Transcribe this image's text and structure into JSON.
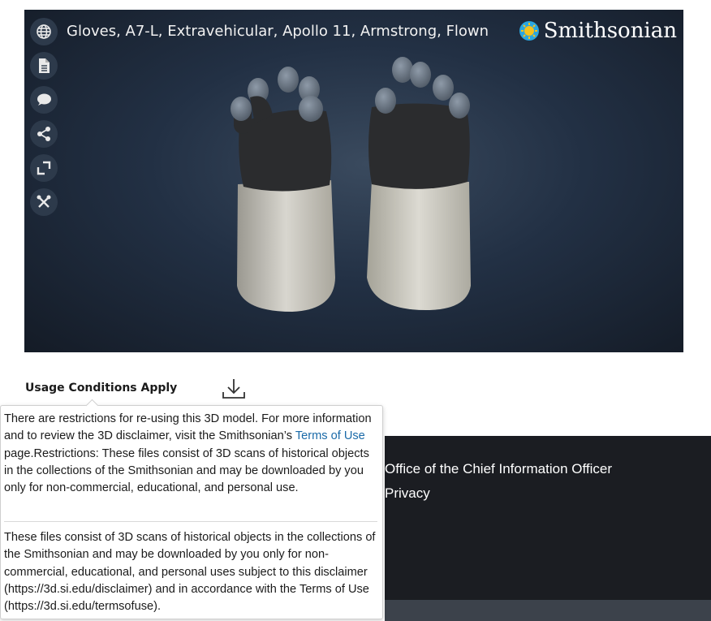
{
  "viewer": {
    "title": "Gloves, A7-L, Extravehicular, Apollo 11, Armstrong, Flown",
    "brand": "Smithsonian",
    "tools": [
      "language-icon",
      "document-icon",
      "comment-icon",
      "share-icon",
      "fullscreen-icon",
      "tools-icon"
    ]
  },
  "usage": {
    "label": "Usage Conditions Apply",
    "download_icon": "download-icon"
  },
  "popover": {
    "p1_before": "There are restrictions for re-using this 3D model. For more information and to review the 3D disclaimer, visit the Smithsonian’s ",
    "terms_link": "Terms of Use",
    "p1_after": " page.Restrictions: These files consist of 3D scans of historical objects in the collections of the Smithsonian and may be downloaded by you only for non-commercial, educational, and personal use.",
    "p2": "These files consist of 3D scans of historical objects in the collections of the Smithsonian and may be downloaded by you only for non-commercial, educational, and personal uses subject to this disclaimer (https://3d.si.edu/disclaimer) and in accordance with the Terms of Use (https://3d.si.edu/termsofuse)."
  },
  "footer": {
    "links": [
      "Office of the Chief Information Officer",
      "Privacy"
    ]
  },
  "colors": {
    "link": "#1a6aa8",
    "footer_bg": "#1b1d22",
    "viewer_bg": "#223044"
  }
}
